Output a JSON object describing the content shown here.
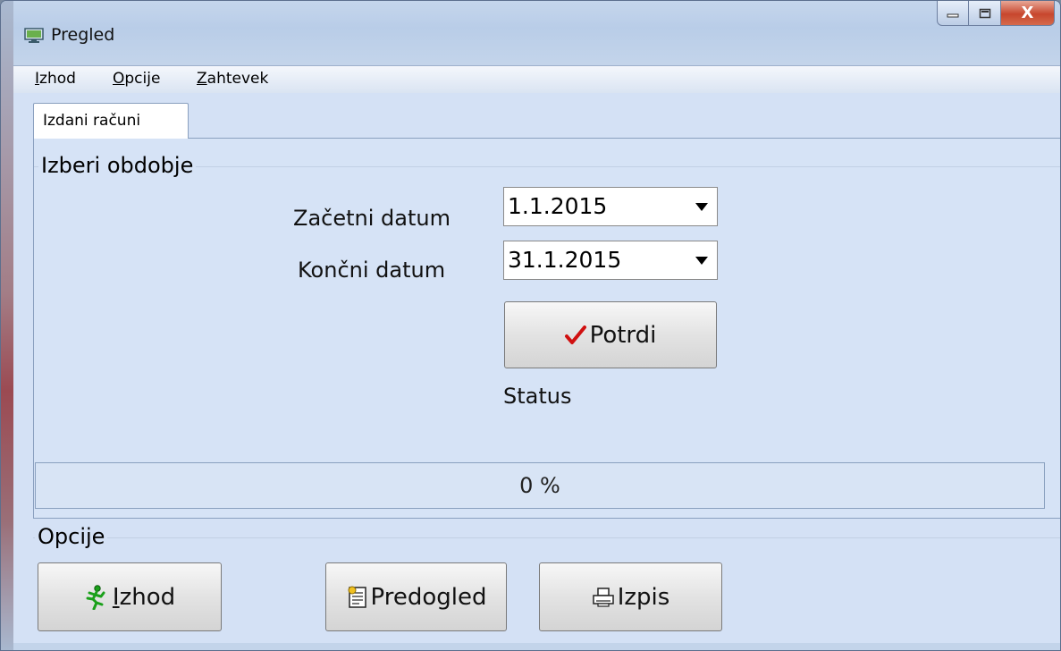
{
  "window": {
    "title": "Pregled"
  },
  "caption_buttons": {
    "close": "X"
  },
  "menu": [
    {
      "accel": "I",
      "rest": "zhod"
    },
    {
      "accel": "O",
      "rest": "pcije"
    },
    {
      "accel": "Z",
      "rest": "ahtevek"
    }
  ],
  "tabs": [
    {
      "label": "Izdani računi"
    }
  ],
  "period_group": {
    "title": "Izberi obdobje",
    "start_label": "Začetni datum",
    "start_value": "1.1.2015",
    "end_label": "Končni datum",
    "end_value": "31.1.2015",
    "confirm_label": "Potrdi",
    "status_label": "Status"
  },
  "progress": {
    "text": "0 %",
    "value": 0
  },
  "options_group": {
    "title": "Opcije",
    "exit_accel": "I",
    "exit_rest": "zhod",
    "preview_label": "Predogled",
    "print_label": "Izpis"
  },
  "colors": {
    "check": "#d01010",
    "runner": "#1aa01a",
    "close_button": "#c7462d"
  }
}
